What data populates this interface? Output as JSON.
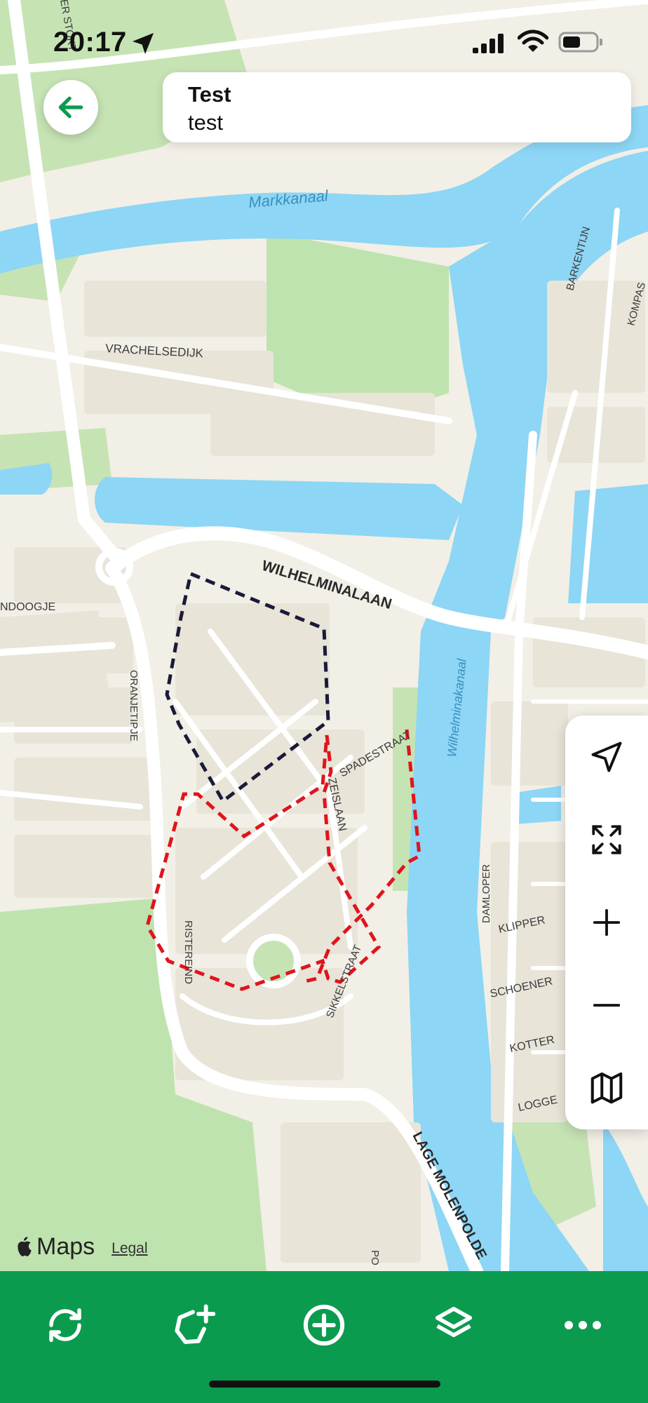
{
  "status_bar": {
    "time": "20:17"
  },
  "header": {
    "title": "Test",
    "subtitle": "test"
  },
  "map_labels": {
    "markkanaal": "Markkanaal",
    "wilhelminakanaal": "Wilhelminakanaal",
    "wilhelminalaan": "WILHELMINALAAN",
    "vrachelsedijk": "VRACHELSEDIJK",
    "barkentijn": "BARKENTIJN",
    "kompas": "KOMPAS",
    "oranjetipje": "ORANJETIPJE",
    "ndoogje": "NDOOGJE",
    "spadestraat": "SPADESTRAAT",
    "zeislaan": "ZEISLAAN",
    "risterend": "RISTEREIND",
    "sikkelstraat": "SIKKELSTRAAT",
    "damloper": "DAMLOPER",
    "klipper": "KLIPPER",
    "schoener": "SCHOENER",
    "kotter": "KOTTER",
    "logge": "LOGGE",
    "lage_molenpolder": "LAGE MOLENPOLDE",
    "stokt": "ER STOKT",
    "po": "PO"
  },
  "attribution": {
    "maps": "Maps",
    "legal": "Legal"
  },
  "icons": {
    "back": "arrow-left-icon",
    "locate": "navigation-arrow-icon",
    "fit": "expand-icon",
    "zoom_in": "plus-icon",
    "zoom_out": "minus-icon",
    "map_type": "map-icon",
    "sync": "sync-icon",
    "add_area": "add-polygon-icon",
    "add_point": "add-circle-icon",
    "layers": "layers-icon",
    "more": "more-horizontal-icon"
  },
  "colors": {
    "accent": "#0b9b4f",
    "water": "#8dd6f5",
    "park": "#b9e1a6",
    "polygon_dark": "#1a1a3a",
    "polygon_red": "#e0141c"
  }
}
